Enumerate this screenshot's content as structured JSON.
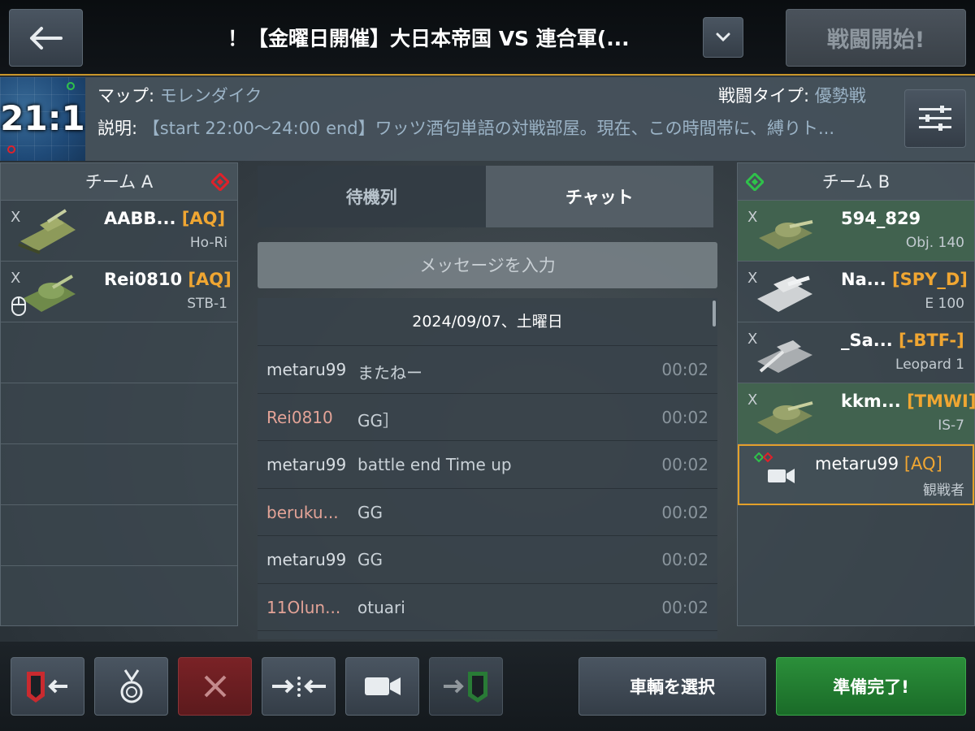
{
  "header": {
    "title": "！【金曜日開催】大日本帝国 VS 連合軍(...",
    "start_label": "戦闘開始!"
  },
  "info": {
    "score": "21:1",
    "map_label": "マップ:",
    "map_value": "モレンダイク",
    "battle_type_label": "戦闘タイプ:",
    "battle_type_value": "優勢戦",
    "desc_label": "説明:",
    "desc_value": "【start 22:00～24:00 end】ワッツ酒匂単語の対戦部屋。現在、この時間帯に、縛りト..."
  },
  "team_a": {
    "title": "チーム A",
    "players": [
      {
        "x": "X",
        "name": "AABB...",
        "clan": "[AQ]",
        "vehicle": "Ho-Ri"
      },
      {
        "x": "X",
        "name": "Rei0810",
        "clan": "[AQ]",
        "vehicle": "STB-1"
      }
    ]
  },
  "team_b": {
    "title": "チーム B",
    "players": [
      {
        "x": "X",
        "name": "594_829",
        "clan": "",
        "vehicle": "Obj. 140"
      },
      {
        "x": "X",
        "name": "Na...",
        "clan": "[SPY_D]",
        "vehicle": "E 100"
      },
      {
        "x": "X",
        "name": "_Sa...",
        "clan": "[-BTF-]",
        "vehicle": "Leopard 1"
      },
      {
        "x": "X",
        "name": "kkm...",
        "clan": "[TMWI]",
        "vehicle": "IS-7"
      }
    ],
    "spectator": {
      "name": "metaru99",
      "clan": "[AQ]",
      "role": "観戦者"
    }
  },
  "tabs": {
    "queue": "待機列",
    "chat": "チャット"
  },
  "chat": {
    "placeholder": "メッセージを入力",
    "date": "2024/09/07、土曜日",
    "messages": [
      {
        "author": "metaru99",
        "text": "またねー",
        "time": "00:02",
        "color": "#d7dde2"
      },
      {
        "author": "Rei0810",
        "text": "GG］",
        "time": "00:02",
        "color": "#e3a397"
      },
      {
        "author": "metaru99",
        "text": "battle end Time up",
        "time": "00:02",
        "color": "#d7dde2"
      },
      {
        "author": "beruku...",
        "text": "GG",
        "time": "00:02",
        "color": "#e3a397"
      },
      {
        "author": "metaru99",
        "text": "GG",
        "time": "00:02",
        "color": "#d7dde2"
      },
      {
        "author": "11Olun...",
        "text": "otuari",
        "time": "00:02",
        "color": "#e3a397"
      }
    ]
  },
  "footer": {
    "select_vehicle": "車輌を選択",
    "ready": "準備完了!"
  },
  "colors": {
    "accent_gold": "#c9962a",
    "clan_orange": "#f0a632",
    "team_a_red": "#e0212a",
    "team_b_green": "#2fc24a",
    "ready_green": "#2b8f3a"
  }
}
